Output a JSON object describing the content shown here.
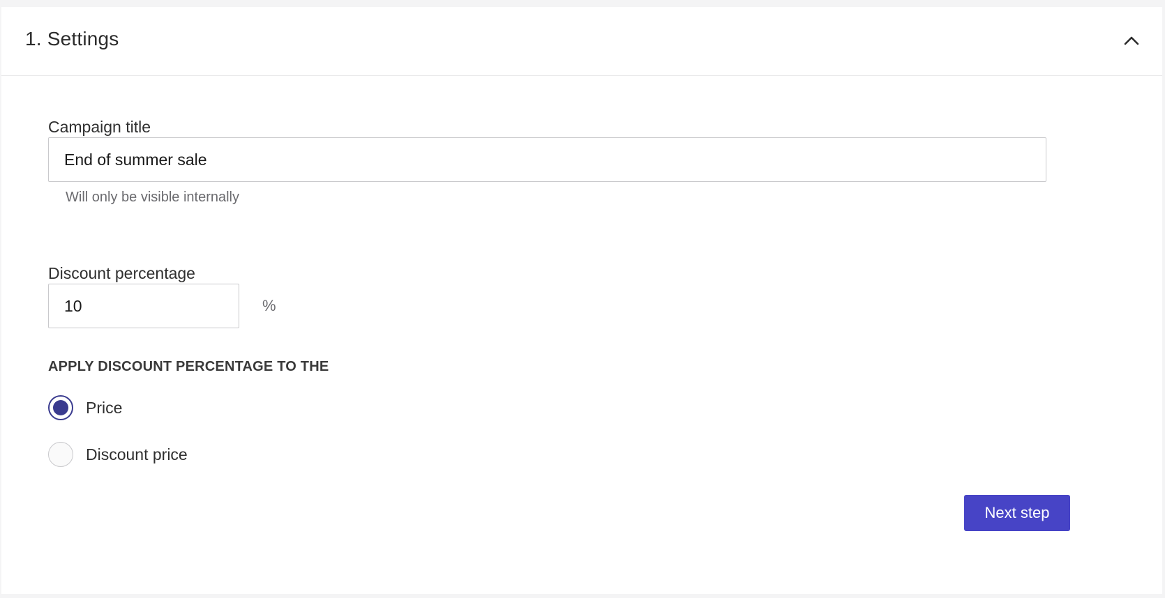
{
  "header": {
    "title": "1. Settings",
    "toggle_icon": "chevron-up-icon"
  },
  "campaign": {
    "label": "Campaign title",
    "value": "End of summer sale",
    "helper": "Will only be visible internally"
  },
  "discount": {
    "label": "Discount percentage",
    "value": "10",
    "unit": "%"
  },
  "apply": {
    "heading": "APPLY DISCOUNT PERCENTAGE TO THE",
    "options": [
      {
        "label": "Price",
        "selected": true
      },
      {
        "label": "Discount price",
        "selected": false
      }
    ]
  },
  "actions": {
    "next_label": "Next step"
  },
  "colors": {
    "accent": "#4744c6",
    "radio_selected": "#3a3b8f"
  }
}
